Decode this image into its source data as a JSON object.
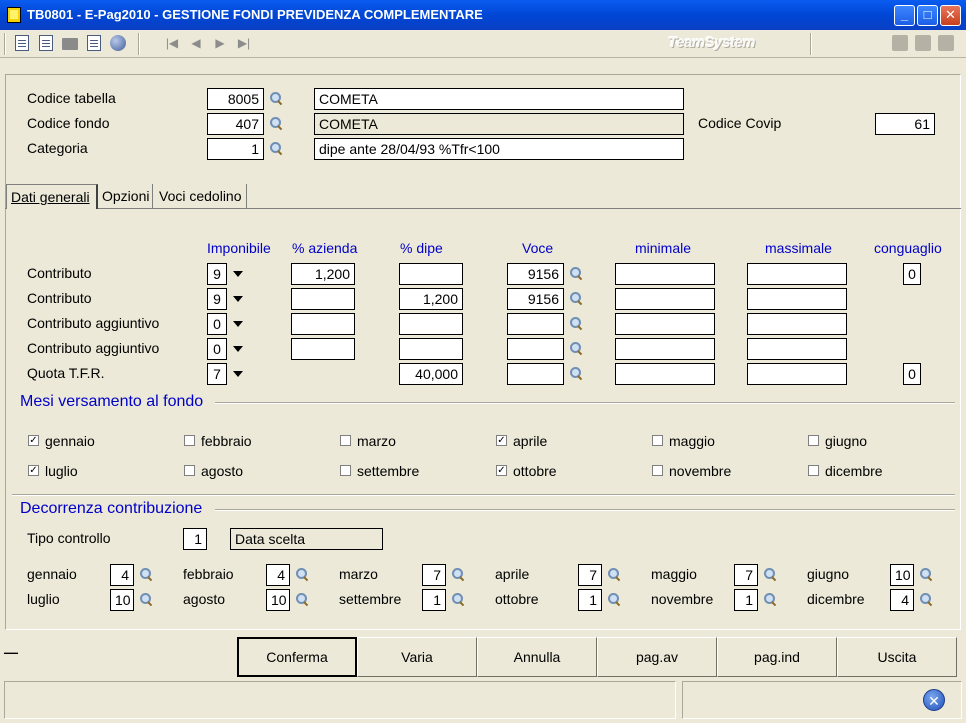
{
  "window": {
    "title": "TB0801  -  E-Pag2010  -  GESTIONE FONDI PREVIDENZA COMPLEMENTARE",
    "min": "_",
    "max": "□",
    "close": "✕"
  },
  "toolbar": {
    "brand": "TeamSystem",
    "nav": [
      "|◀",
      "◀",
      "▶",
      "▶|"
    ]
  },
  "header": {
    "codice_tabella_label": "Codice tabella",
    "codice_tabella_value": "8005",
    "codice_tabella_desc": "COMETA",
    "codice_fondo_label": "Codice fondo",
    "codice_fondo_value": "407",
    "codice_fondo_desc": "COMETA",
    "categoria_label": "Categoria",
    "categoria_value": "1",
    "categoria_desc": "dipe ante 28/04/93 %Tfr<100",
    "codice_covip_label": "Codice Covip",
    "codice_covip_value": "61"
  },
  "tabs": [
    "Dati generali",
    "Opzioni",
    "Voci cedolino"
  ],
  "columns": {
    "imponibile": "Imponibile",
    "azienda": "% azienda",
    "dipe": "% dipe",
    "voce": "Voce",
    "minimale": "minimale",
    "massimale": "massimale",
    "conguaglio": "conguaglio"
  },
  "rows": [
    {
      "label": "Contributo",
      "imponibile": "9",
      "azienda": "1,200",
      "dipe": "",
      "voce": "9156",
      "minimale": "",
      "massimale": "",
      "conguaglio": "0"
    },
    {
      "label": "Contributo",
      "imponibile": "9",
      "azienda": "",
      "dipe": "1,200",
      "voce": "9156",
      "minimale": "",
      "massimale": "",
      "conguaglio": ""
    },
    {
      "label": "Contributo aggiuntivo",
      "imponibile": "0",
      "azienda": "",
      "dipe": "",
      "voce": "",
      "minimale": "",
      "massimale": "",
      "conguaglio": ""
    },
    {
      "label": "Contributo aggiuntivo",
      "imponibile": "0",
      "azienda": "",
      "dipe": "",
      "voce": "",
      "minimale": "",
      "massimale": "",
      "conguaglio": ""
    },
    {
      "label": "Quota T.F.R.",
      "imponibile": "7",
      "azienda": "",
      "dipe": "40,000",
      "voce": "",
      "minimale": "",
      "massimale": "",
      "conguaglio": "0"
    }
  ],
  "mesi": {
    "title": "Mesi versamento al fondo",
    "items": [
      {
        "label": "gennaio",
        "checked": true
      },
      {
        "label": "febbraio",
        "checked": false
      },
      {
        "label": "marzo",
        "checked": false
      },
      {
        "label": "aprile",
        "checked": true
      },
      {
        "label": "maggio",
        "checked": false
      },
      {
        "label": "giugno",
        "checked": false
      },
      {
        "label": "luglio",
        "checked": true
      },
      {
        "label": "agosto",
        "checked": false
      },
      {
        "label": "settembre",
        "checked": false
      },
      {
        "label": "ottobre",
        "checked": true
      },
      {
        "label": "novembre",
        "checked": false
      },
      {
        "label": "dicembre",
        "checked": false
      }
    ]
  },
  "decorrenza": {
    "title": "Decorrenza contribuzione",
    "tipo_label": "Tipo controllo",
    "tipo_value": "1",
    "tipo_desc": "Data scelta",
    "months": [
      {
        "label": "gennaio",
        "value": "4"
      },
      {
        "label": "febbraio",
        "value": "4"
      },
      {
        "label": "marzo",
        "value": "7"
      },
      {
        "label": "aprile",
        "value": "7"
      },
      {
        "label": "maggio",
        "value": "7"
      },
      {
        "label": "giugno",
        "value": "10"
      },
      {
        "label": "luglio",
        "value": "10"
      },
      {
        "label": "agosto",
        "value": "10"
      },
      {
        "label": "settembre",
        "value": "1"
      },
      {
        "label": "ottobre",
        "value": "1"
      },
      {
        "label": "novembre",
        "value": "1"
      },
      {
        "label": "dicembre",
        "value": "4"
      }
    ]
  },
  "buttons": {
    "conferma": "Conferma",
    "varia": "Varia",
    "annulla": "Annulla",
    "pag_av": "pag.av",
    "pag_ind": "pag.ind",
    "uscita": "Uscita"
  },
  "status": {
    "left_mark": "—"
  },
  "icons": {
    "exit": "exit-icon",
    "lookup": "magnifier-icon"
  }
}
